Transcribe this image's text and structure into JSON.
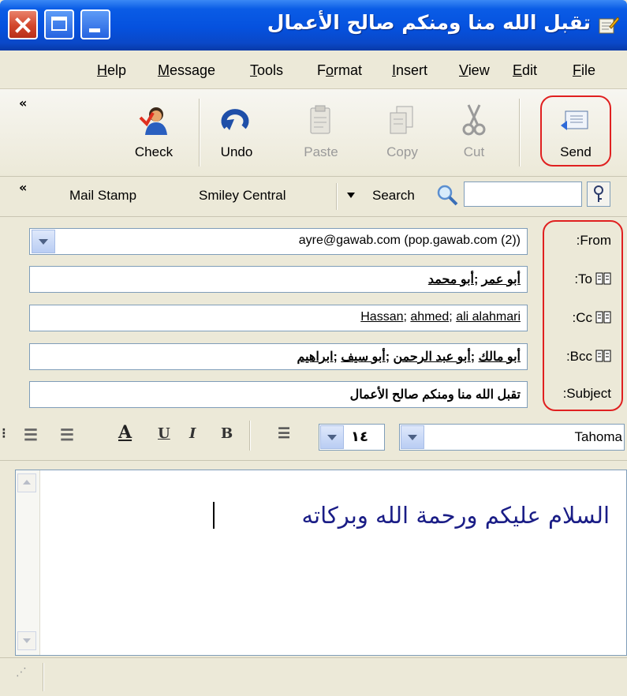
{
  "window": {
    "title": "تقبل الله منا ومنكم صالح الأعمال"
  },
  "menu": [
    {
      "label": "Help",
      "key": "H",
      "rest": "elp"
    },
    {
      "label": "Message",
      "key": "M",
      "rest": "essage"
    },
    {
      "label": "Tools",
      "key": "T",
      "rest": "ools"
    },
    {
      "label": "Format",
      "key": "o",
      "pre": "F",
      "rest": "rmat"
    },
    {
      "label": "Insert",
      "key": "I",
      "rest": "nsert"
    },
    {
      "label": "View",
      "key": "V",
      "rest": "iew"
    },
    {
      "label": "Edit",
      "key": "E",
      "rest": "dit"
    },
    {
      "label": "File",
      "key": "F",
      "rest": "ile"
    }
  ],
  "toolbar": {
    "chevron": "«",
    "check": "Check",
    "undo": "Undo",
    "paste": "Paste",
    "copy": "Copy",
    "cut": "Cut",
    "send": "Send"
  },
  "toolbar2": {
    "chevron": "«",
    "mail_stamp": "Mail Stamp",
    "smiley_central": "Smiley Central",
    "search_label": "Search"
  },
  "headers": {
    "from_label": ":From",
    "from_value": "ayre@gawab.com    (pop.gawab.com (2))",
    "to_label": ":To",
    "to_recipients": [
      "أبو عمر",
      "أبو محمد"
    ],
    "cc_label": ":Cc",
    "cc_recipients": [
      "Hassan",
      "ahmed",
      "ali alahmari"
    ],
    "bcc_label": ":Bcc",
    "bcc_recipients": [
      "أبو مالك",
      "أبو عبد الرحمن",
      "أبو سيف",
      "ابراهيم"
    ],
    "subject_label": ":Subject",
    "subject_value": "تقبل الله منا ومنكم صالح الأعمال"
  },
  "format": {
    "font_name": "Tahoma",
    "font_size": "١٤"
  },
  "body": {
    "text": "السلام عليكم ورحمة الله وبركاته"
  },
  "colors": {
    "titlebar": "#0551de",
    "highlight_ring": "#e02020",
    "body_text": "#1a1d86"
  }
}
